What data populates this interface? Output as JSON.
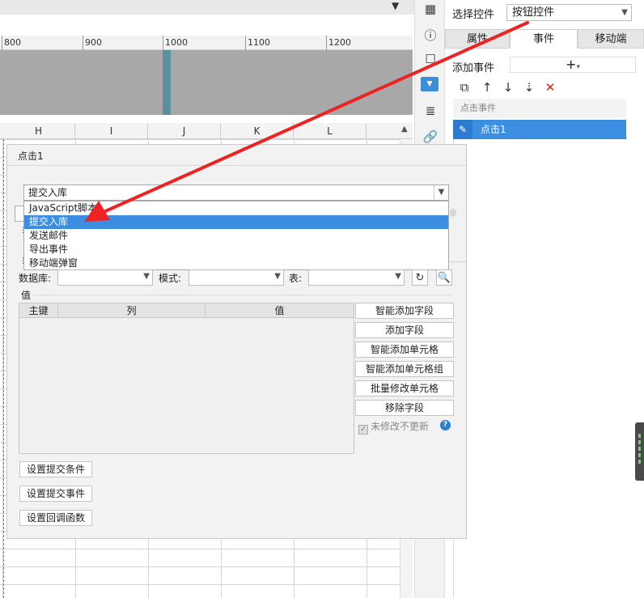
{
  "ruler": {
    "ticks": [
      "800",
      "900",
      "1000",
      "1100",
      "1200"
    ]
  },
  "sheet": {
    "columns": [
      "H",
      "I",
      "J",
      "K",
      "L"
    ]
  },
  "right_panel": {
    "select_label": "选择控件",
    "select_value": "按钮控件",
    "tabs": [
      "属性",
      "事件",
      "移动端"
    ],
    "active_tab": "事件",
    "add_event_label": "添加事件",
    "add_event_symbol": "+",
    "event_list_header": "点击事件",
    "event_item": "点击1"
  },
  "dialog": {
    "title": "点击1",
    "action_selected": "提交入库",
    "action_options": [
      "JavaScript脚本",
      "提交入库",
      "发送邮件",
      "导出事件",
      "移动端弹窗"
    ],
    "database_label": "数据库:",
    "schema_label": "模式:",
    "table_label": "表:",
    "values_label": "值",
    "table_headers": [
      "主键",
      "列",
      "值"
    ],
    "side_buttons": [
      "智能添加字段",
      "添加字段",
      "智能添加单元格",
      "智能添加单元格组",
      "批量修改单元格",
      "移除字段"
    ],
    "no_change_label": "未修改不更新",
    "bottom_buttons": [
      "设置提交条件",
      "设置提交事件",
      "设置回调函数"
    ]
  },
  "colors": {
    "accent": "#3c8fe0",
    "arrow": "#ee2222",
    "delete": "#e02020"
  }
}
